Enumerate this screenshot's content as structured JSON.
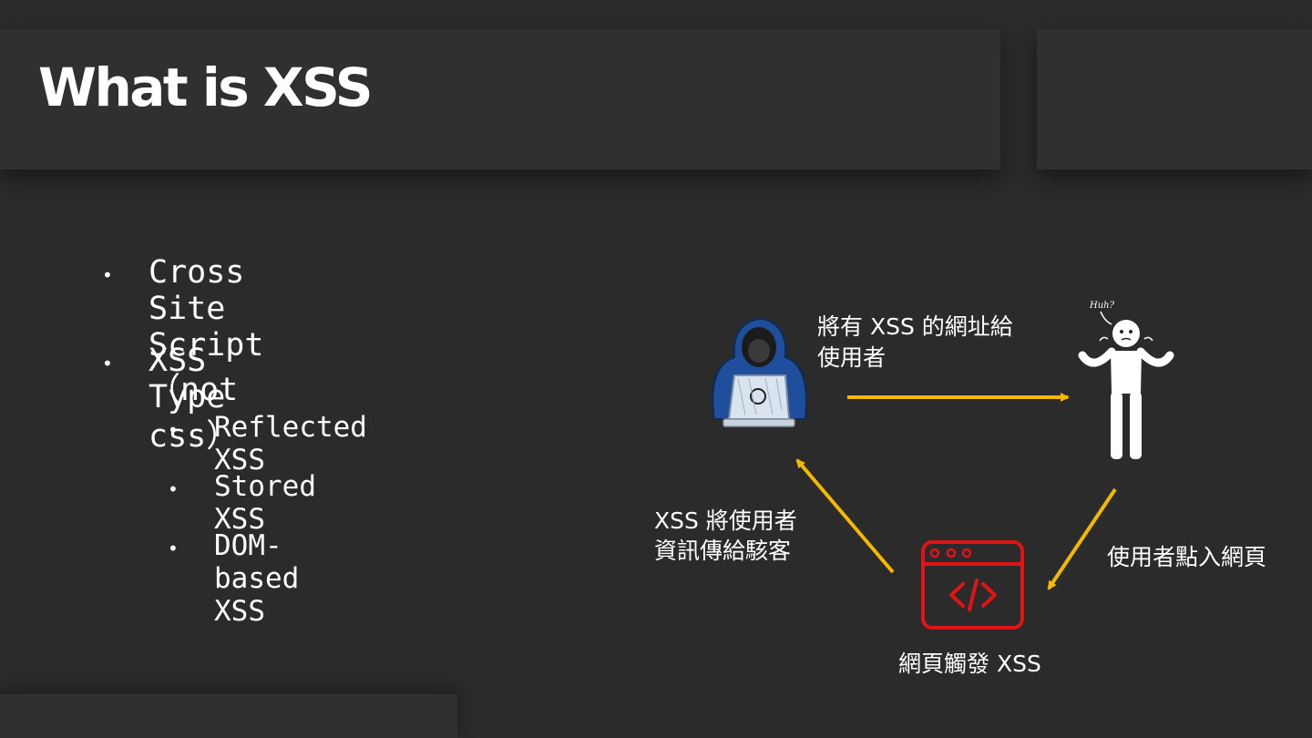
{
  "slide": {
    "title": "What is XSS",
    "bullets": [
      {
        "label": "Cross Site Script（not css）"
      },
      {
        "label": "XSS Type"
      }
    ],
    "sub_bullets": [
      {
        "label": "Reflected XSS"
      },
      {
        "label": "Stored XSS"
      },
      {
        "label": "DOM-based XSS"
      }
    ]
  },
  "diagram": {
    "step1_line1": "將有 XSS 的網址給",
    "step1_line2": "使用者",
    "step2": "使用者點入網頁",
    "step3": "網頁觸發 XSS",
    "step4_line1": "XSS 將使用者",
    "step4_line2": "資訊傳給駭客",
    "user_speech": "Huh?",
    "colors": {
      "arrow": "#f5b800",
      "webpage_icon": "#e01414",
      "hacker": "#1f4f9c"
    }
  }
}
